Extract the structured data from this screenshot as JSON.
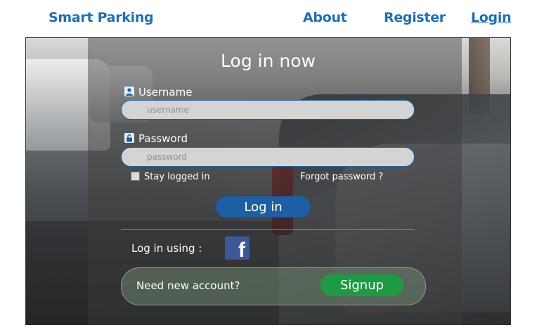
{
  "nav": {
    "brand": "Smart Parking",
    "about": "About",
    "register": "Register",
    "login": "Login"
  },
  "form": {
    "title": "Log in now",
    "username_label": "Username",
    "username_placeholder": "username",
    "password_label": "Password",
    "password_placeholder": "password",
    "remember_label": "Stay logged in",
    "remember_checked": false,
    "forgot_link": "Forgot password ?",
    "login_button": "Log in",
    "social_label": "Log in using :",
    "social_icon": "facebook-icon",
    "signup_prompt": "Need new account?",
    "signup_button": "Signup"
  },
  "colors": {
    "nav_link": "#1f6fb3",
    "primary_button": "#1e5fa3",
    "signup_button": "#1e9a43",
    "facebook": "#3b5998"
  }
}
